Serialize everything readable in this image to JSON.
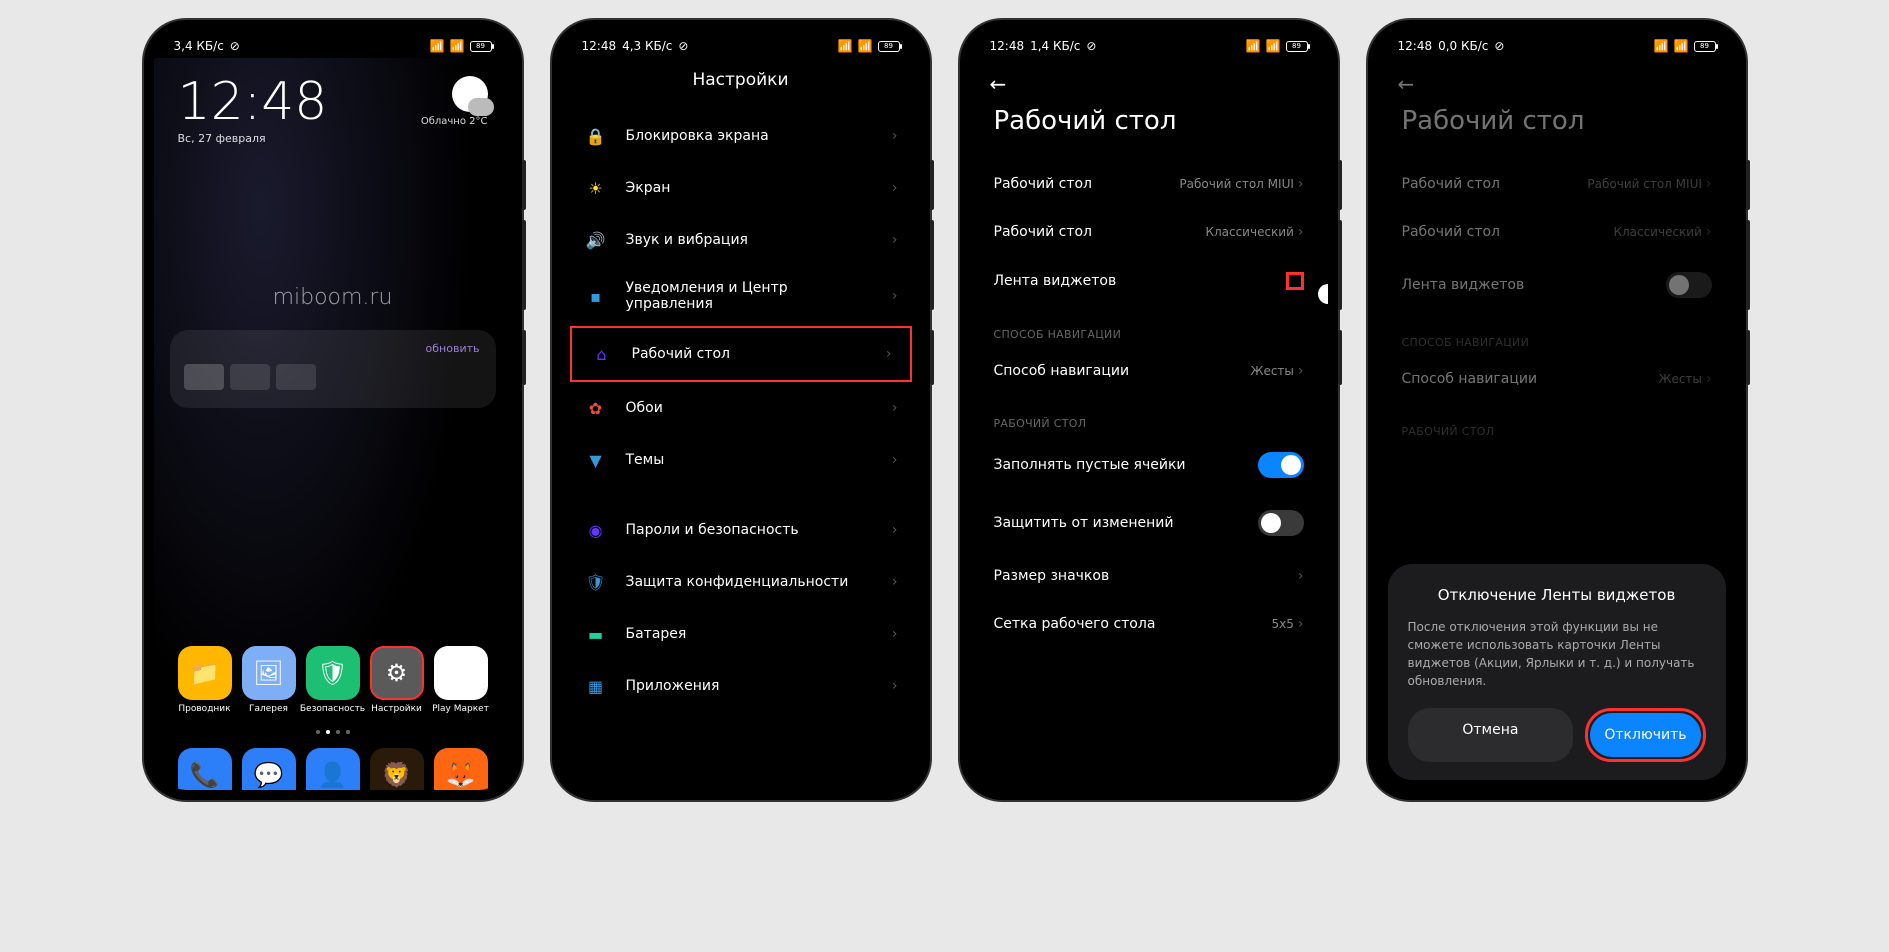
{
  "common": {
    "time": "12:48",
    "battery": "89"
  },
  "screen1": {
    "speed": "3,4 КБ/с",
    "clock": "12:48",
    "date": "Вс, 27 февраля",
    "weather_cond": "Облачно",
    "weather_temp": "2°C",
    "watermark": "miboom.ru",
    "widget_update": "обновить",
    "apps_row1": [
      {
        "label": "Проводник",
        "bg": "#ffb700",
        "glyph": "📁"
      },
      {
        "label": "Галерея",
        "bg": "#7eaef5",
        "glyph": "🖼"
      },
      {
        "label": "Безопасность",
        "bg": "#1dbf73",
        "glyph": "🛡"
      },
      {
        "label": "Настройки",
        "bg": "#5a5a5a",
        "glyph": "⚙"
      },
      {
        "label": "Play Маркет",
        "bg": "#fff",
        "glyph": "▶"
      }
    ],
    "dock": [
      {
        "bg": "#2d7ff9",
        "glyph": "📞"
      },
      {
        "bg": "#2d7ff9",
        "glyph": "💬"
      },
      {
        "bg": "#2d7ff9",
        "glyph": "👤"
      },
      {
        "bg": "#2a1a0a",
        "glyph": "🦁"
      },
      {
        "bg": "#ff6611",
        "glyph": "🦊"
      }
    ]
  },
  "screen2": {
    "speed": "4,3 КБ/с",
    "title": "Настройки",
    "items": [
      {
        "label": "Блокировка экрана",
        "icon": "🔒",
        "color": "#ff4757"
      },
      {
        "label": "Экран",
        "icon": "☀",
        "color": "#ffd93d"
      },
      {
        "label": "Звук и вибрация",
        "icon": "🔊",
        "color": "#1dd1a1"
      },
      {
        "label": "Уведомления и Центр управления",
        "icon": "▪",
        "color": "#3498db"
      },
      {
        "label": "Рабочий стол",
        "icon": "⌂",
        "color": "#6633ff",
        "highlight": true
      },
      {
        "label": "Обои",
        "icon": "✿",
        "color": "#e74c3c"
      },
      {
        "label": "Темы",
        "icon": "▼",
        "color": "#3498db"
      }
    ],
    "items2": [
      {
        "label": "Пароли и безопасность",
        "icon": "◉",
        "color": "#6633ff"
      },
      {
        "label": "Защита конфиденциальности",
        "icon": "🛡",
        "color": "#3498db"
      },
      {
        "label": "Батарея",
        "icon": "▬",
        "color": "#1dd1a1"
      },
      {
        "label": "Приложения",
        "icon": "▦",
        "color": "#3498db"
      }
    ]
  },
  "screen3": {
    "speed": "1,4 КБ/с",
    "title": "Рабочий стол",
    "opts": [
      {
        "label": "Рабочий стол",
        "value": "Рабочий стол MIUI"
      },
      {
        "label": "Рабочий стол",
        "value": "Классический"
      }
    ],
    "widget_feed": "Лента виджетов",
    "nav_header": "СПОСОБ НАВИГАЦИИ",
    "nav": {
      "label": "Способ навигации",
      "value": "Жесты"
    },
    "desk_header": "РАБОЧИЙ СТОЛ",
    "desk_opts": [
      {
        "label": "Заполнять пустые ячейки",
        "toggle": true
      },
      {
        "label": "Защитить от изменений",
        "toggle": false
      },
      {
        "label": "Размер значков"
      },
      {
        "label": "Сетка рабочего стола",
        "value": "5x5"
      }
    ]
  },
  "screen4": {
    "speed": "0,0 КБ/с",
    "title": "Рабочий стол",
    "opts": [
      {
        "label": "Рабочий стол",
        "value": "Рабочий стол MIUI"
      },
      {
        "label": "Рабочий стол",
        "value": "Классический"
      }
    ],
    "widget_feed": "Лента виджетов",
    "nav_header": "СПОСОБ НАВИГАЦИИ",
    "nav": {
      "label": "Способ навигации",
      "value": "Жесты"
    },
    "desk_header": "РАБОЧИЙ СТОЛ",
    "dialog": {
      "title": "Отключение Ленты виджетов",
      "text": "После отключения этой функции вы не сможете использовать карточки Ленты виджетов (Акции, Ярлыки и т. д.) и получать обновления.",
      "cancel": "Отмена",
      "confirm": "Отключить"
    }
  }
}
